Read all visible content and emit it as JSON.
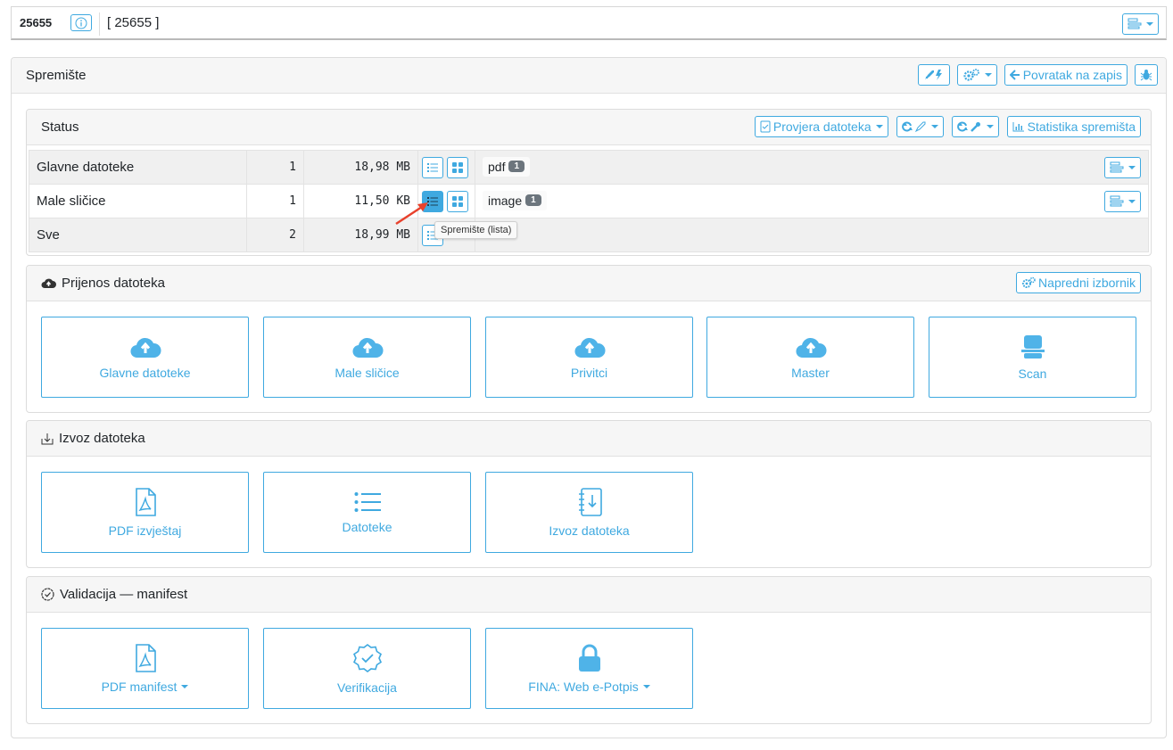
{
  "topbar": {
    "record_id": "25655",
    "record_title": "[ 25655 ]"
  },
  "panel": {
    "title": "Spremište",
    "back_label": "Povratak na zapis"
  },
  "status": {
    "title": "Status",
    "check_label": "Provjera datoteka",
    "stats_label": "Statistika spremišta",
    "rows": [
      {
        "name": "Glavne datoteke",
        "count": "1",
        "size": "18,98 MB",
        "tag": "pdf",
        "tag_count": "1"
      },
      {
        "name": "Male sličice",
        "count": "1",
        "size": "11,50 KB",
        "tag": "image",
        "tag_count": "1"
      },
      {
        "name": "Sve",
        "count": "2",
        "size": "18,99 MB"
      }
    ],
    "tooltip": "Spremište (lista)"
  },
  "upload": {
    "title": "Prijenos datoteka",
    "advanced_label": "Napredni izbornik",
    "tiles": [
      "Glavne datoteke",
      "Male sličice",
      "Privitci",
      "Master",
      "Scan"
    ]
  },
  "export": {
    "title": "Izvoz datoteka",
    "tiles": [
      "PDF izvještaj",
      "Datoteke",
      "Izvoz datoteka"
    ]
  },
  "validation": {
    "title": "Validacija — manifest",
    "tiles": [
      "PDF manifest",
      "Verifikacija",
      "FINA: Web e-Potpis"
    ]
  },
  "colors": {
    "accent": "#3fa9e0",
    "badge": "#6c757d",
    "header_bg": "#f6f6f6"
  }
}
